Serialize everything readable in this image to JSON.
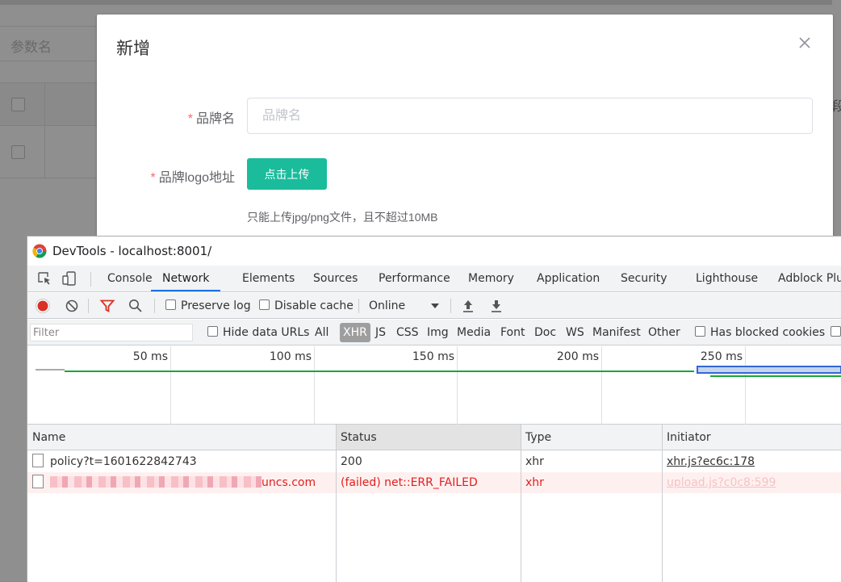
{
  "background": {
    "field_label": "参数名",
    "right_partial_text": "段"
  },
  "dialog": {
    "title": "新增",
    "brand_name": {
      "label": "品牌名",
      "placeholder": "品牌名",
      "value": ""
    },
    "brand_logo": {
      "label": "品牌logo地址",
      "button": "点击上传",
      "tip": "只能上传jpg/png文件，且不超过10MB"
    }
  },
  "devtools": {
    "window_title": "DevTools - localhost:8001/",
    "tabs": [
      "Console",
      "Network",
      "Elements",
      "Sources",
      "Performance",
      "Memory",
      "Application",
      "Security",
      "Lighthouse",
      "Adblock Plu"
    ],
    "active_tab": "Network",
    "toolbar": {
      "preserve_log": "Preserve log",
      "disable_cache": "Disable cache",
      "throttle": "Online"
    },
    "filter": {
      "placeholder": "Filter",
      "hide_data_urls": "Hide data URLs",
      "types": [
        "All",
        "XHR",
        "JS",
        "CSS",
        "Img",
        "Media",
        "Font",
        "Doc",
        "WS",
        "Manifest",
        "Other"
      ],
      "active_type": "XHR",
      "has_blocked_cookies": "Has blocked cookies"
    },
    "timeline_ticks": [
      "50 ms",
      "100 ms",
      "150 ms",
      "200 ms",
      "250 ms"
    ],
    "table": {
      "columns": [
        "Name",
        "Status",
        "Type",
        "Initiator"
      ],
      "rows": [
        {
          "name": "policy?t=1601622842743",
          "status": "200",
          "type": "xhr",
          "initiator": "xhr.js?ec6c:178",
          "error": false
        },
        {
          "name": "uncs.com",
          "status": "(failed) net::ERR_FAILED",
          "type": "xhr",
          "initiator": "upload.js?c0c8:599",
          "error": true
        }
      ]
    }
  },
  "colors": {
    "primary_button": "#1abc9c",
    "required_star": "#f56c6c",
    "error_text": "#e0201e",
    "active_tab_underline": "#1a73e8"
  }
}
